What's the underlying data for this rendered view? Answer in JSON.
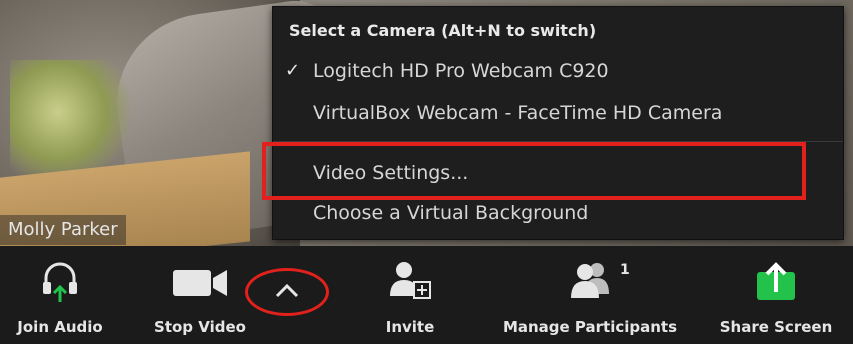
{
  "participant": {
    "name": "Molly Parker"
  },
  "camera_menu": {
    "header": "Select a Camera (Alt+N to switch)",
    "cameras": [
      {
        "label": "Logitech HD Pro Webcam C920",
        "selected": true
      },
      {
        "label": "VirtualBox Webcam - FaceTime HD Camera",
        "selected": false
      }
    ],
    "video_settings": "Video Settings...",
    "virtual_background": "Choose a Virtual Background",
    "check_glyph": "✓"
  },
  "toolbar": {
    "join_audio": "Join Audio",
    "stop_video": "Stop Video",
    "invite": "Invite",
    "manage_participants": "Manage Participants",
    "participant_count": "1",
    "share_screen": "Share Screen"
  },
  "colors": {
    "accent_green": "#23c34b",
    "annotation_red": "#e2211c",
    "toolbar_bg": "#1b1b1b"
  }
}
